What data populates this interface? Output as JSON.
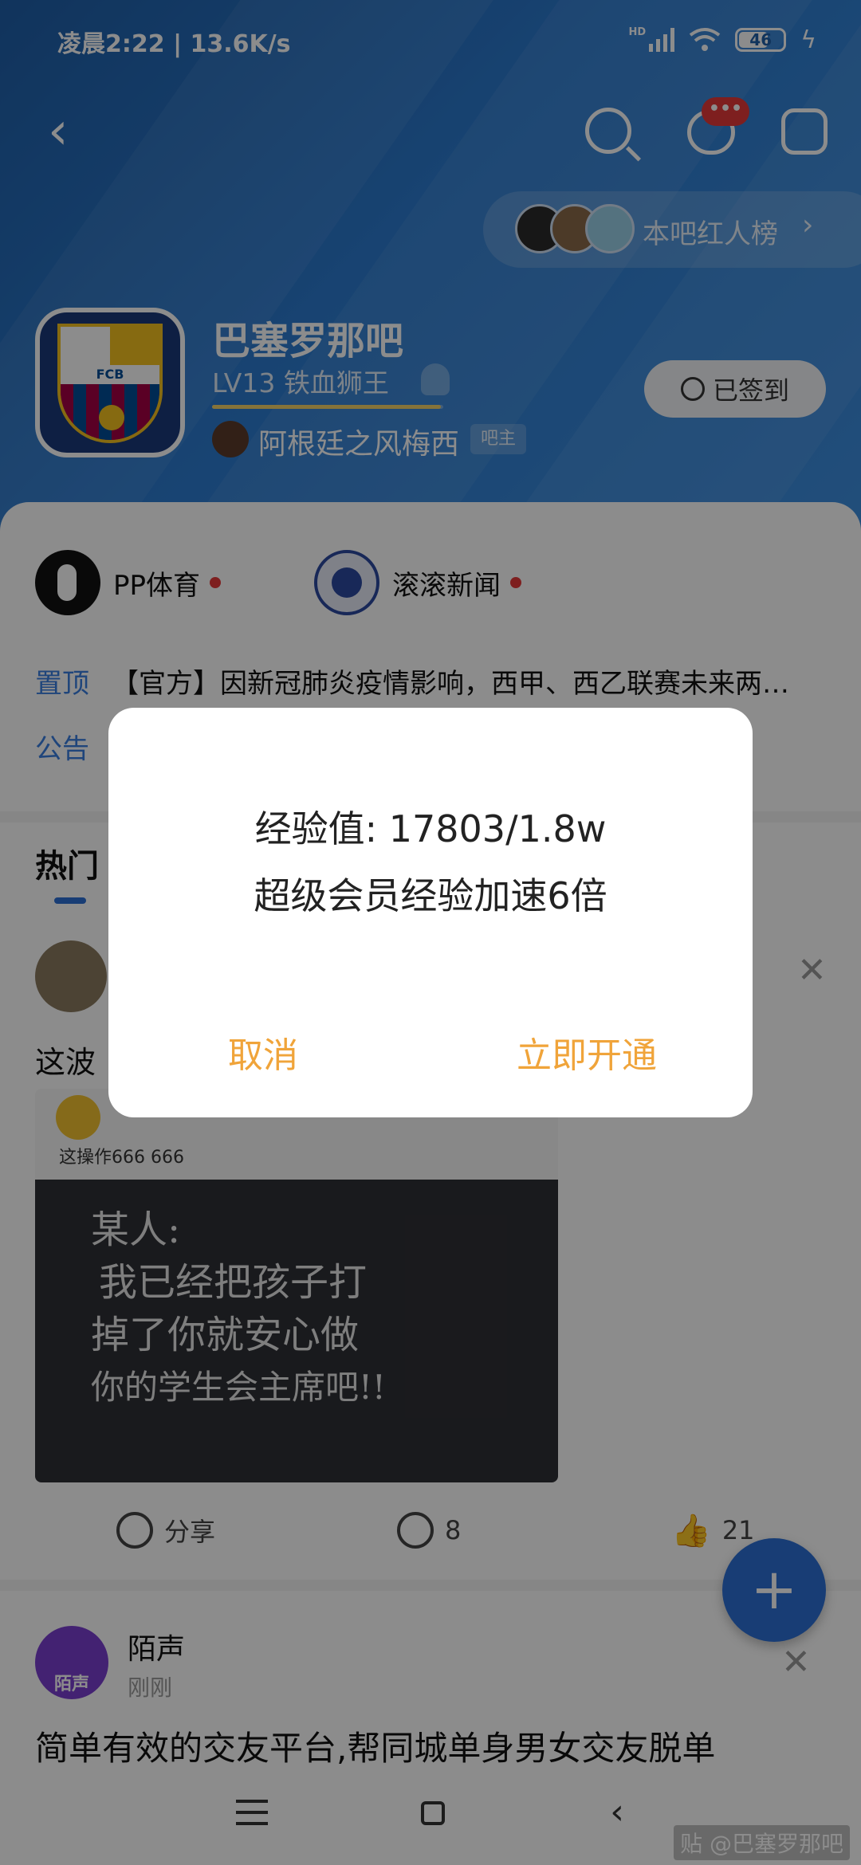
{
  "status_bar": {
    "time_speed": "凌晨2:22 | 13.6K/s",
    "hd": "HD",
    "battery": "46"
  },
  "header": {
    "unread_badge": "•••",
    "redlist_label": "本吧红人榜",
    "forum_name": "巴塞罗那吧",
    "level": "LV13   铁血狮王",
    "level_progress": 0.99,
    "owner_name": "阿根廷之风梅西",
    "owner_badge": "吧主",
    "signed_label": "已签到"
  },
  "promos": [
    {
      "name": "PP体育"
    },
    {
      "name": "滚滚新闻"
    }
  ],
  "pinned": {
    "label": "置顶",
    "text": "【官方】因新冠肺炎疫情影响，西甲、西乙联赛未来两…"
  },
  "notice": {
    "label": "公告"
  },
  "tabs": {
    "hot": "热门"
  },
  "post": {
    "title": "这波",
    "image_caption": "这操作666 666",
    "chalk": [
      "某人:",
      "我已经把孩子打",
      "掉了你就安心做",
      "你的学生会主席吧!!"
    ],
    "share_label": "分享",
    "comment_count": "8",
    "like_count": "21"
  },
  "ad": {
    "avatar_label": "陌声",
    "name": "陌声",
    "time": "刚刚",
    "text": "简单有效的交友平台,帮同城单身男女交友脱单"
  },
  "watermark": "贴 @巴塞罗那吧",
  "dialog": {
    "line1": "经验值: 17803/1.8w",
    "line2": "超级会员经验加速6倍",
    "cancel": "取消",
    "confirm": "立即开通"
  },
  "colors": {
    "header_blue": "#2c7bd0",
    "accent_orange": "#f0a43a",
    "link_blue": "#3a7ee0",
    "red_dot": "#e53a3a"
  }
}
